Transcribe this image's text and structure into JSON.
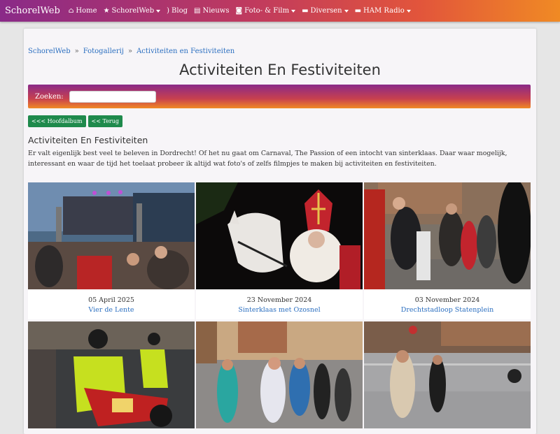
{
  "nav": {
    "brand": "SchorelWeb",
    "items": [
      {
        "label": "Home",
        "icon": "home-icon",
        "dropdown": false
      },
      {
        "label": "SchorelWeb",
        "icon": "star-icon",
        "dropdown": true
      },
      {
        "label": "Blog",
        "icon": "rss-icon",
        "dropdown": false
      },
      {
        "label": "Nieuws",
        "icon": "newspaper-icon",
        "dropdown": false
      },
      {
        "label": "Foto- & Film",
        "icon": "camera-icon",
        "dropdown": true
      },
      {
        "label": "Diversen",
        "icon": "folder-icon",
        "dropdown": true
      },
      {
        "label": "HAM Radio",
        "icon": "folder-icon",
        "dropdown": true
      }
    ]
  },
  "breadcrumb": [
    "SchorelWeb",
    "Fotogallerij",
    "Activiteiten en Festiviteiten"
  ],
  "page_title": "Activiteiten En Festiviteiten",
  "search": {
    "label": "Zoeken:",
    "value": "",
    "placeholder": ""
  },
  "buttons": {
    "back_main": "<<< Hoofdalbum",
    "back": "<< Terug"
  },
  "section": {
    "title": "Activiteiten En Festiviteiten",
    "description": "Er valt eigenlijk best veel te beleven in Dordrecht! Of het nu gaat om Carnaval, The Passion of een intocht van sinterklaas. Daar waar mogelijk, interessant en waar de tijd het toelaat probeer ik altijd wat foto's of zelfs filmpjes te maken bij activiteiten en festiviteiten."
  },
  "albums": [
    {
      "date": "05 April 2025",
      "title": "Vier de Lente"
    },
    {
      "date": "23 November 2024",
      "title": "Sinterklaas met Ozosnel"
    },
    {
      "date": "03 November 2024",
      "title": "Drechtstadloop Statenplein"
    },
    {
      "date": "",
      "title": ""
    },
    {
      "date": "",
      "title": ""
    },
    {
      "date": "",
      "title": ""
    }
  ],
  "colors": {
    "link": "#2b6fc0",
    "button": "#1f8a4c",
    "gradient_start": "#8a2a88",
    "gradient_end": "#f08a24"
  }
}
